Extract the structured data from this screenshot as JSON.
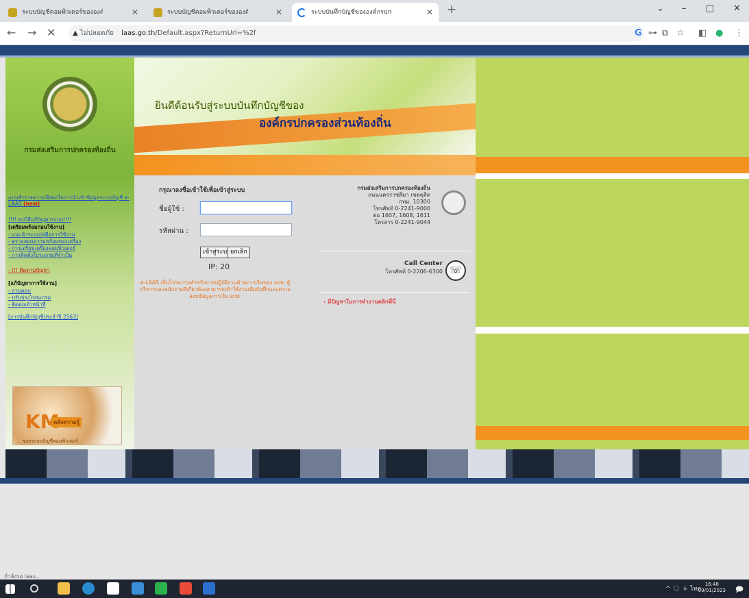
{
  "browser": {
    "tabs": [
      {
        "title": "ระบบบัญชีคอมพิวเตอร์ขององค์กรปกครองส่วนท้องถิ่น - e-LAAS"
      },
      {
        "title": "ระบบบัญชีคอมพิวเตอร์ขององค์กรปกครองส่วนท้องถิ่น - e-LAAS"
      },
      {
        "title": "ระบบบันทึกบัญชีขององค์กรปกครองส่วนท้องถิ่น"
      }
    ],
    "new_tab": "+",
    "win_controls": [
      "⌄",
      "–",
      "□",
      "✕"
    ],
    "nav": {
      "back": "←",
      "forward": "→",
      "stop": "✕"
    },
    "url_warning": "▲",
    "url_security": "ไม่ปลอดภัย",
    "url_domain": "laas.go.th",
    "url_path": "/Default.aspx?ReturnUrl=%2f",
    "extensions": [
      "G",
      "⊶",
      "⧉",
      "☆",
      "◧",
      "●",
      "⋮"
    ]
  },
  "sidebar": {
    "dept_name": "กรมส่งเสริมการปกครองท้องถิ่น",
    "links_top": [
      "แบบสำรวจความพึงพอใจการนำเข้าข้อมูลระบบบัญชี e-LAAS",
      "(new)"
    ],
    "header1": "[เตรียมพร้อมก่อนใช้งาน]",
    "prep_label": "!!!! พบวิธีแก้ปัญหาระบบ!!!!",
    "items1": [
      "- แนะนำระบบ/คู่มือการใช้งาน",
      "- ตรวจสอบความพร้อมของเครื่อง",
      "- การเตรียมเครื่องคอมพิวเตอร์",
      "- การติดตั้งโปรแกรมที่จำเป็น",
      "- !!! ติดตามปัญหา"
    ],
    "header2": "[แก้ปัญหาการใช้งาน]",
    "items2": [
      "- ถามตอบ",
      "- ปรับปรุงโปรแกรม",
      "- ติดต่อเจ้าหน้าที่"
    ],
    "link_bottom": "[การบันทึกบัญชีประจำปี 2563]",
    "km_logo": "KM",
    "km_text": "คลังความรู้",
    "km_sub": "ของระบบบัญชีคอมพิวเตอร์"
  },
  "header": {
    "welcome_line1": "ยินดีต้อนรับสู่ระบบบันทึกบัญชีของ",
    "welcome_line2": "องค์กรปกครองส่วนท้องถิ่น"
  },
  "login": {
    "title": "กรุณาลงชื่อเข้าใช้เพื่อเข้าสู่ระบบ",
    "username_label": "ชื่อผู้ใช้ :",
    "password_label": "รหัสผ่าน :",
    "username_value": "",
    "password_value": "",
    "login_button": "เข้าสู่ระบบ",
    "cancel_button": "ยกเลิก",
    "ip": "IP: 20",
    "notice": "e-LAAS เป็นโปรแกรมสำหรับการปฏิบัติงานด้านการเงินของ อปท. ผู้บริหารและพนักงานที่เกี่ยวข้องสามารถเข้าใช้งานเพื่อบันทึกและตรวจสอบข้อมูลการเงิน อปท."
  },
  "contact": {
    "org": "กรมส่งเสริมการปกครองท้องถิ่น",
    "lines": [
      "ถนนนครราชสีมา เขตดุสิต",
      "กทม. 10300",
      "โทรศัพท์ 0-2241-9000",
      "ต่อ 1607, 1608, 1611",
      "โทรสาร 0-2241-9044"
    ],
    "call_center": "Call Center",
    "call_phone": "โทรศัพท์ 0-2206-6300",
    "problem_link": "› มีปัญหาในการทำงานคลิกที่นี่"
  },
  "statusbar": {
    "text": "กำลังรอ laas..."
  },
  "taskbar": {
    "tray": "^ 🗨 ⏚ ไทย",
    "time": "16:48",
    "date": "09/01/2023",
    "notif": "🗩"
  },
  "colors": {
    "navy": "#24477a",
    "green": "#bdd65e",
    "orange": "#f3921f"
  }
}
